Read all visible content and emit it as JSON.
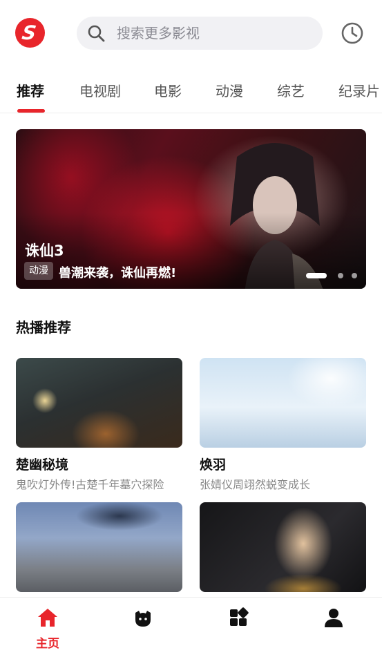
{
  "header": {
    "logo_letter": "S",
    "search_placeholder": "搜索更多影视"
  },
  "tabs": [
    {
      "label": "推荐",
      "active": true
    },
    {
      "label": "电视剧",
      "active": false
    },
    {
      "label": "电影",
      "active": false
    },
    {
      "label": "动漫",
      "active": false
    },
    {
      "label": "综艺",
      "active": false
    },
    {
      "label": "纪录片",
      "active": false
    }
  ],
  "banner": {
    "title": "诛仙3",
    "tag": "动漫",
    "description": "兽潮来袭，诛仙再燃!",
    "page_count": 3,
    "active_page": 1
  },
  "section": {
    "title": "热播推荐"
  },
  "cards": [
    {
      "title": "楚幽秘境",
      "subtitle": "鬼吹灯外传!古楚千年墓穴探险"
    },
    {
      "title": "焕羽",
      "subtitle": "张婧仪周翊然蜕变成长"
    },
    {
      "title": "",
      "subtitle": ""
    },
    {
      "title": "",
      "subtitle": ""
    }
  ],
  "bottom_nav": {
    "items": [
      {
        "label": "主页",
        "icon": "home-icon",
        "active": true
      },
      {
        "label": "",
        "icon": "mascot-icon",
        "active": false
      },
      {
        "label": "",
        "icon": "grid-icon",
        "active": false
      },
      {
        "label": "",
        "icon": "user-icon",
        "active": false
      }
    ]
  },
  "colors": {
    "accent": "#e8252b",
    "search_bg": "#f1f1f4",
    "muted_text": "#888888"
  }
}
